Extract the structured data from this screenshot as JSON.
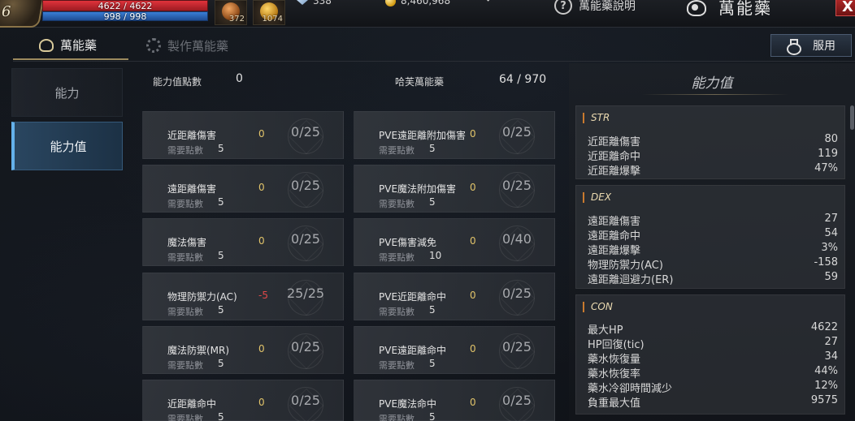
{
  "hud": {
    "level": "6",
    "hp_text": "4622 / 4622",
    "mp_text": "998 / 998",
    "hp_fraction": 1.0,
    "mp_fraction": 1.0,
    "slot1_count": "372",
    "slot2_count": "1074",
    "currency1": "338",
    "currency2": "8,460,968",
    "help_label": "萬能藥說明",
    "window_title": "萬能藥",
    "close_label": "X"
  },
  "tabs": [
    {
      "label": "萬能藥",
      "active": true
    },
    {
      "label": "製作萬能藥",
      "active": false
    }
  ],
  "use_button": "服用",
  "side": [
    {
      "label": "能力"
    },
    {
      "label": "能力值"
    }
  ],
  "summary": {
    "points_label": "能力值點數",
    "points_value": "0",
    "potion_label": "哈芙萬能藥",
    "potion_value": "64 / 970"
  },
  "req_label": "需要點數",
  "left_cards": [
    {
      "name": "近距離傷害",
      "value": "0",
      "progress": "0/25",
      "req": "5"
    },
    {
      "name": "遠距離傷害",
      "value": "0",
      "progress": "0/25",
      "req": "5"
    },
    {
      "name": "魔法傷害",
      "value": "0",
      "progress": "0/25",
      "req": "5"
    },
    {
      "name": "物理防禦力(AC)",
      "value": "-5",
      "progress": "25/25",
      "req": "5"
    },
    {
      "name": "魔法防禦(MR)",
      "value": "0",
      "progress": "0/25",
      "req": "5"
    },
    {
      "name": "近距離命中",
      "value": "0",
      "progress": "0/25",
      "req": "5"
    }
  ],
  "right_cards": [
    {
      "name": "PVE遠距離附加傷害",
      "value": "0",
      "progress": "0/25",
      "req": "5"
    },
    {
      "name": "PVE魔法附加傷害",
      "value": "0",
      "progress": "0/25",
      "req": "5"
    },
    {
      "name": "PVE傷害減免",
      "value": "0",
      "progress": "0/40",
      "req": "10"
    },
    {
      "name": "PVE近距離命中",
      "value": "0",
      "progress": "0/25",
      "req": "5"
    },
    {
      "name": "PVE遠距離命中",
      "value": "0",
      "progress": "0/25",
      "req": "5"
    },
    {
      "name": "PVE魔法命中",
      "value": "0",
      "progress": "0/25",
      "req": "5"
    }
  ],
  "stats_panel": {
    "title": "能力值",
    "groups": [
      {
        "head": "STR",
        "rows": [
          {
            "label": "近距離傷害",
            "value": "80"
          },
          {
            "label": "近距離命中",
            "value": "119"
          },
          {
            "label": "近距離爆擊",
            "value": "47%"
          }
        ]
      },
      {
        "head": "DEX",
        "rows": [
          {
            "label": "遠距離傷害",
            "value": "27"
          },
          {
            "label": "遠距離命中",
            "value": "54"
          },
          {
            "label": "遠距離爆擊",
            "value": "3%"
          },
          {
            "label": "物理防禦力(AC)",
            "value": "-158"
          },
          {
            "label": "遠距離迴避力(ER)",
            "value": "59"
          }
        ]
      },
      {
        "head": "CON",
        "rows": [
          {
            "label": "最大HP",
            "value": "4622"
          },
          {
            "label": "HP回復(tic)",
            "value": "27"
          },
          {
            "label": "藥水恢復量",
            "value": "34"
          },
          {
            "label": "藥水恢復率",
            "value": "44%"
          },
          {
            "label": "藥水冷卻時間減少",
            "value": "12%"
          },
          {
            "label": "負重最大值",
            "value": "9575"
          }
        ]
      }
    ]
  },
  "colors": {
    "accent_blue": "#64b1ea",
    "hp_red": "#e0333b",
    "mp_blue": "#3a7fd6",
    "negative": "#e04848",
    "value_gold": "#e2c46a"
  }
}
